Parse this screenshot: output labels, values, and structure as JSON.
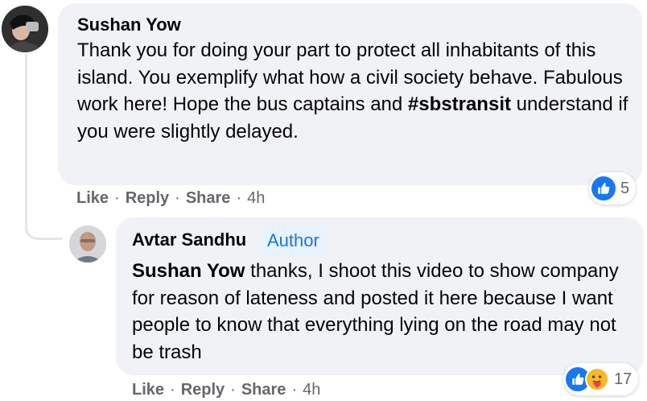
{
  "comment": {
    "author": "Sushan Yow",
    "text": "Thank you for doing your part to protect all inhabitants of this island. You exemplify what how a civil society behave. Fabulous work here! Hope the bus captains and",
    "hashtag": "#sbstransit",
    "text_after": "understand if you were slightly delayed.",
    "actions": {
      "like": "Like",
      "reply": "Reply",
      "share": "Share",
      "time": "4h",
      "sep": "·"
    },
    "reaction_count": "5"
  },
  "reply": {
    "author": "Avtar Sandhu",
    "badge": "Author",
    "mention": "Sushan Yow",
    "text": "thanks, I shoot this video to show company for reason of lateness and posted it here because I want people to know that everything lying on the road may not be trash",
    "actions": {
      "like": "Like",
      "reply": "Reply",
      "share": "Share",
      "time": "4h",
      "sep": "·"
    },
    "reaction_count": "17"
  },
  "colors": {
    "bubble": "#f0f2f5",
    "like": "#1877f2",
    "badge_bg": "#e7f3ff",
    "badge_text": "#1b74e4",
    "meta": "#65676b"
  },
  "icons": {
    "like": "thumbs-up-icon",
    "care": "care-reaction-icon"
  }
}
